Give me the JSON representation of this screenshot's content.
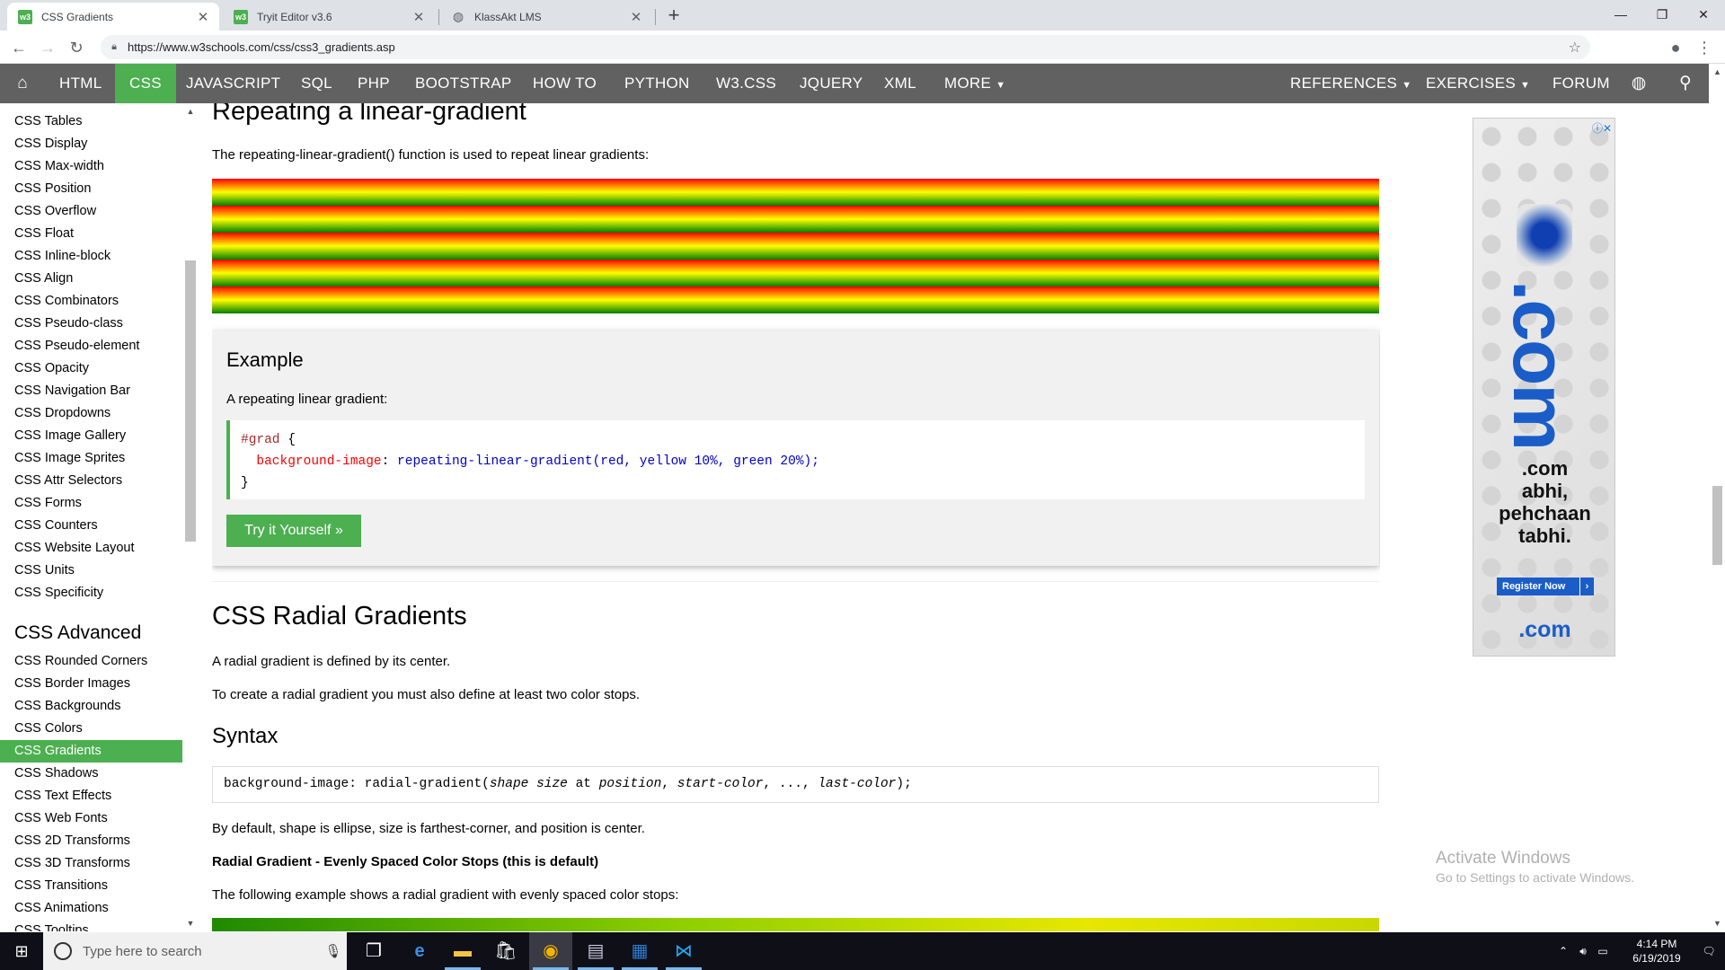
{
  "browser": {
    "tabs": [
      {
        "title": "CSS Gradients",
        "favicon": "w3schools-icon",
        "active": true
      },
      {
        "title": "Tryit Editor v3.6",
        "favicon": "w3schools-icon",
        "active": false
      },
      {
        "title": "KlassAkt LMS",
        "favicon": "globe-icon",
        "active": false
      }
    ],
    "url": "https://www.w3schools.com/css/css3_gradients.asp"
  },
  "topnav": {
    "home_icon": "home-icon",
    "items": [
      "HTML",
      "CSS",
      "JAVASCRIPT",
      "SQL",
      "PHP",
      "BOOTSTRAP",
      "HOW TO",
      "PYTHON",
      "W3.CSS",
      "JQUERY",
      "XML",
      "MORE"
    ],
    "active_item": "CSS",
    "right_items": [
      "REFERENCES",
      "EXERCISES",
      "FORUM"
    ],
    "accent": "#4CAF50",
    "bar_color": "#616161"
  },
  "sidebar": {
    "links_top": [
      "CSS Tables",
      "CSS Display",
      "CSS Max-width",
      "CSS Position",
      "CSS Overflow",
      "CSS Float",
      "CSS Inline-block",
      "CSS Align",
      "CSS Combinators",
      "CSS Pseudo-class",
      "CSS Pseudo-element",
      "CSS Opacity",
      "CSS Navigation Bar",
      "CSS Dropdowns",
      "CSS Image Gallery",
      "CSS Image Sprites",
      "CSS Attr Selectors",
      "CSS Forms",
      "CSS Counters",
      "CSS Website Layout",
      "CSS Units",
      "CSS Specificity"
    ],
    "heading": "CSS Advanced",
    "links_advanced": [
      "CSS Rounded Corners",
      "CSS Border Images",
      "CSS Backgrounds",
      "CSS Colors",
      "CSS Gradients",
      "CSS Shadows",
      "CSS Text Effects",
      "CSS Web Fonts",
      "CSS 2D Transforms",
      "CSS 3D Transforms",
      "CSS Transitions",
      "CSS Animations",
      "CSS Tooltips"
    ],
    "active_link": "CSS Gradients"
  },
  "main": {
    "repeat_heading": "Repeating a linear-gradient",
    "repeat_desc": "The repeating-linear-gradient() function is used to repeat linear gradients:",
    "example": {
      "title": "Example",
      "desc": "A repeating linear gradient:",
      "code": {
        "selector": "#grad",
        "open": " {",
        "prop": "background-image",
        "colon": ": ",
        "value": "repeating-linear-gradient(red, yellow 10%, green 20%);",
        "close": "}"
      },
      "button": "Try it Yourself »"
    },
    "radial_heading": "CSS Radial Gradients",
    "radial_p1": "A radial gradient is defined by its center.",
    "radial_p2": "To create a radial gradient you must also define at least two color stops.",
    "syntax_heading": "Syntax",
    "syntax": {
      "prefix": "background-image: radial-gradient(",
      "shape_size": "shape size",
      "at": " at ",
      "position": "position",
      "comma1": ", ",
      "start": "start-color",
      "mid": ", ..., ",
      "last": "last-color",
      "suffix": ");"
    },
    "default_desc": "By default, shape is ellipse, size is farthest-corner, and position is center.",
    "evenly_heading": "Radial Gradient - Evenly Spaced Color Stops (this is default)",
    "evenly_desc": "The following example shows a radial gradient with evenly spaced color stops:"
  },
  "ad": {
    "big_text": ".com",
    "lines": [
      ".com",
      "abhi,",
      "pehchaan",
      "tabhi."
    ],
    "register": "Register Now",
    "logo": ".com"
  },
  "watermark": {
    "line1": "Activate Windows",
    "line2": "Go to Settings to activate Windows."
  },
  "taskbar": {
    "search_placeholder": "Type here to search",
    "time": "4:14 PM",
    "date": "6/19/2019"
  }
}
